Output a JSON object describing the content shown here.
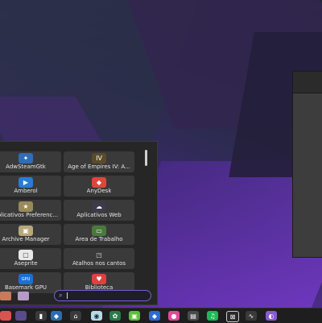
{
  "launcher": {
    "apps": [
      {
        "label": "AdwSteamGtk",
        "icon": "steam-icon",
        "color": "#2f6db5",
        "glyph": "✦"
      },
      {
        "label": "Age of Empires IV: A...",
        "icon": "aoe-icon",
        "color": "#5a4b2b",
        "glyph": "IV"
      },
      {
        "label": "Amberol",
        "icon": "amberol-icon",
        "color": "#2a7bd6",
        "glyph": "▶"
      },
      {
        "label": "AnyDesk",
        "icon": "anydesk-icon",
        "color": "#e0453a",
        "glyph": "◆"
      },
      {
        "label": "Aplicativos Preferenc...",
        "icon": "preferred-apps-icon",
        "color": "#9a8a5a",
        "glyph": "★"
      },
      {
        "label": "Aplicativos Web",
        "icon": "web-apps-icon",
        "color": "#3b3b4b",
        "glyph": "☁"
      },
      {
        "label": "Archive Manager",
        "icon": "archive-icon",
        "color": "#b9a77a",
        "glyph": "▣"
      },
      {
        "label": "Área de Trabalho",
        "icon": "desktop-icon",
        "color": "#4a7a3a",
        "glyph": "▭"
      },
      {
        "label": "Aseprite",
        "icon": "aseprite-icon",
        "color": "#e8e8e8",
        "glyph": "▢"
      },
      {
        "label": "Atalhos nos cantos",
        "icon": "hot-corners-icon",
        "color": "#3a3a3a",
        "glyph": "◳"
      },
      {
        "label": "Basemark GPU",
        "icon": "basemark-icon",
        "color": "#1f6fd1",
        "glyph": "GPU"
      },
      {
        "label": "Biblioteca",
        "icon": "library-icon",
        "color": "#e04040",
        "glyph": "♥"
      }
    ],
    "search": {
      "icon": "search-icon"
    }
  }
}
